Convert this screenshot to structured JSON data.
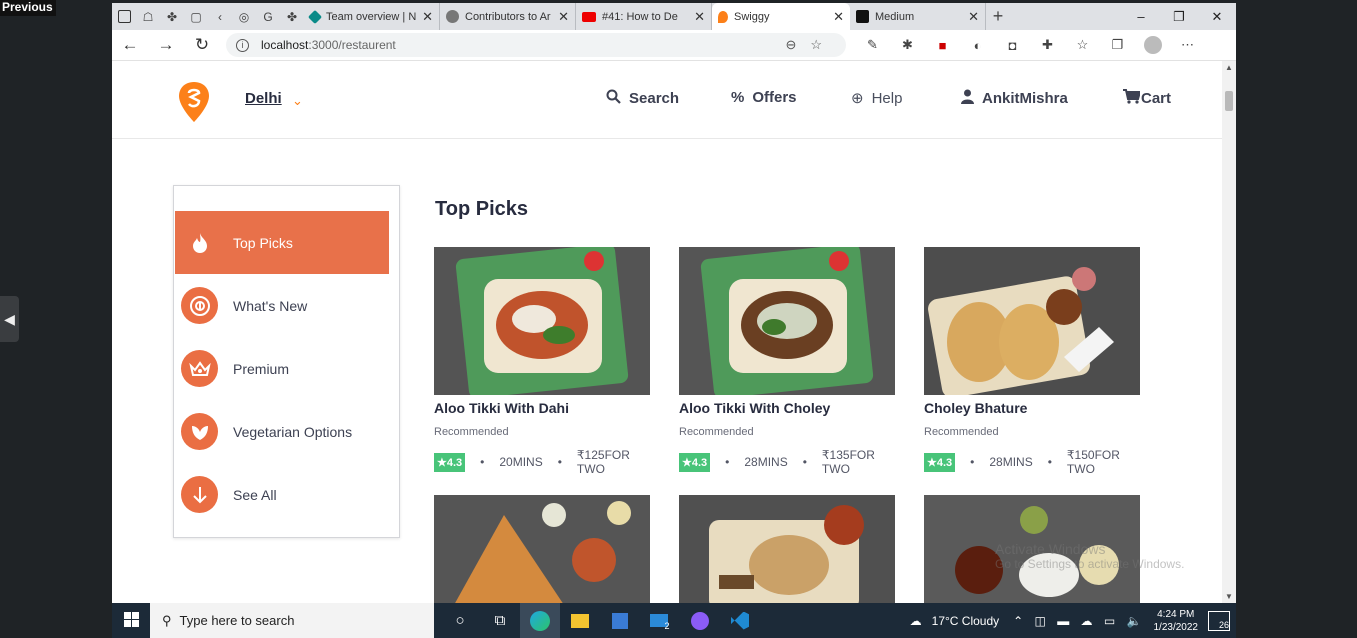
{
  "overlay": {
    "previous_label": "Previous",
    "side_arrow": "◀"
  },
  "browser": {
    "tabs": [
      {
        "label": "Team overview | Ne",
        "color": "#0a8a88"
      },
      {
        "label": "Contributors to Ar",
        "color": "#555555"
      },
      {
        "label": "#41: How to De",
        "color": "#e2441c"
      },
      {
        "label": "Swiggy",
        "color": "#fc8019"
      },
      {
        "label": "Medium",
        "color": "#111111"
      }
    ],
    "active_tab_index": 3,
    "url_host": "localhost",
    "url_rest": ":3000/restaurent",
    "window_controls": {
      "minimize": "–",
      "restore": "❐",
      "close": "✕"
    }
  },
  "header": {
    "city": "Delhi",
    "nav": [
      {
        "label": "Search",
        "icon": "search-icon",
        "glyph": "🔍"
      },
      {
        "label": "Offers",
        "icon": "offers-icon",
        "glyph": "%"
      },
      {
        "label": "Help",
        "icon": "help-icon",
        "glyph": "⊕"
      },
      {
        "label": "AnkitMishra",
        "icon": "user-icon",
        "glyph": "👤"
      },
      {
        "label": "Cart",
        "icon": "cart-icon",
        "glyph": "🛒"
      }
    ]
  },
  "sidebar": {
    "items": [
      {
        "label": "Top Picks",
        "icon": "flame-icon",
        "glyph": "🔥",
        "active": true
      },
      {
        "label": "What's New",
        "icon": "whats-new-icon",
        "glyph": "◉"
      },
      {
        "label": "Premium",
        "icon": "crown-icon",
        "glyph": "♛"
      },
      {
        "label": "Vegetarian Options",
        "icon": "leaf-icon",
        "glyph": "❦"
      },
      {
        "label": "See All",
        "icon": "arrow-down-icon",
        "glyph": "↓"
      }
    ]
  },
  "main": {
    "section_title": "Top Picks",
    "cards": [
      {
        "name": "Aloo Tikki With Dahi",
        "tag": "Recommended",
        "rating": "★4.3",
        "time": "20MINS",
        "price": "₹125FOR TWO"
      },
      {
        "name": "Aloo Tikki With Choley",
        "tag": "Recommended",
        "rating": "★4.3",
        "time": "28MINS",
        "price": "₹135FOR TWO"
      },
      {
        "name": "Choley Bhature",
        "tag": "Recommended",
        "rating": "★4.3",
        "time": "28MINS",
        "price": "₹150FOR TWO"
      }
    ],
    "watermark_line1": "Activate Windows",
    "watermark_line2": "Go to Settings to activate Windows."
  },
  "taskbar": {
    "search_placeholder": "Type here to search",
    "weather": "17°C  Cloudy",
    "time": "4:24 PM",
    "date": "1/23/2022",
    "mail_badge": "2",
    "notifications": "26"
  }
}
